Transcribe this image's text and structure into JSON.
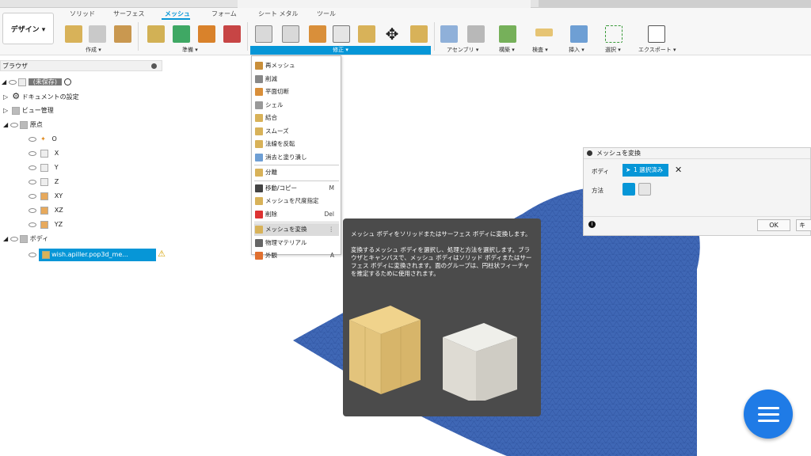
{
  "toolbar": {
    "workspace": "デザイン ▾",
    "tabs": [
      "ソリッド",
      "サーフェス",
      "メッシュ",
      "フォーム",
      "シート メタル",
      "ツール"
    ],
    "groups": [
      "作成 ▾",
      "準備 ▾",
      "修正 ▾",
      "アセンブリ ▾",
      "構築 ▾",
      "検査 ▾",
      "挿入 ▾",
      "選択 ▾",
      "エクスポート ▾"
    ]
  },
  "browser": {
    "title": "ブラウザ",
    "root": "(未保存)",
    "doc_settings": "ドキュメントの設定",
    "view_mgmt": "ビュー管理",
    "origin": "原点",
    "origin_items": [
      "O",
      "X",
      "Y",
      "Z",
      "XY",
      "XZ",
      "YZ"
    ],
    "bodies": "ボディ",
    "mesh_body": "wish.apiller.pop3d_me..."
  },
  "menu": {
    "items": [
      {
        "label": "再メッシュ",
        "sc": ""
      },
      {
        "label": "削減",
        "sc": ""
      },
      {
        "label": "平面切断",
        "sc": ""
      },
      {
        "label": "シェル",
        "sc": ""
      },
      {
        "label": "結合",
        "sc": ""
      },
      {
        "label": "スムーズ",
        "sc": ""
      },
      {
        "label": "法線を反転",
        "sc": ""
      },
      {
        "label": "消去と塗り潰し",
        "sc": ""
      },
      {
        "label": "分離",
        "sc": ""
      },
      {
        "label": "移動/コピー",
        "sc": "M"
      },
      {
        "label": "メッシュを尺度指定",
        "sc": ""
      },
      {
        "label": "削除",
        "sc": "Del"
      },
      {
        "label": "メッシュを変換",
        "sc": ""
      },
      {
        "label": "物理マテリアル",
        "sc": ""
      },
      {
        "label": "外観",
        "sc": "A"
      }
    ]
  },
  "tooltip": {
    "title": "メッシュ ボディをソリッドまたはサーフェス ボディに変換します。",
    "body": "変換するメッシュ ボディを選択し、処理と方法を選択します。ブラウザとキャンバスで、メッシュ ボディはソリッド ボディまたはサーフェス ボディに変換されます。面のグループは、円柱状フィーチャを推定するために使用されます。"
  },
  "dialog": {
    "title": "メッシュを変換",
    "body_label": "ボディ",
    "selected": "1 選択済み",
    "method_label": "方法",
    "ok": "OK",
    "cancel": "キャ"
  },
  "colors": {
    "accent": "#0696d7",
    "mesh": "#3f67b5",
    "fab": "#1f7be6"
  }
}
